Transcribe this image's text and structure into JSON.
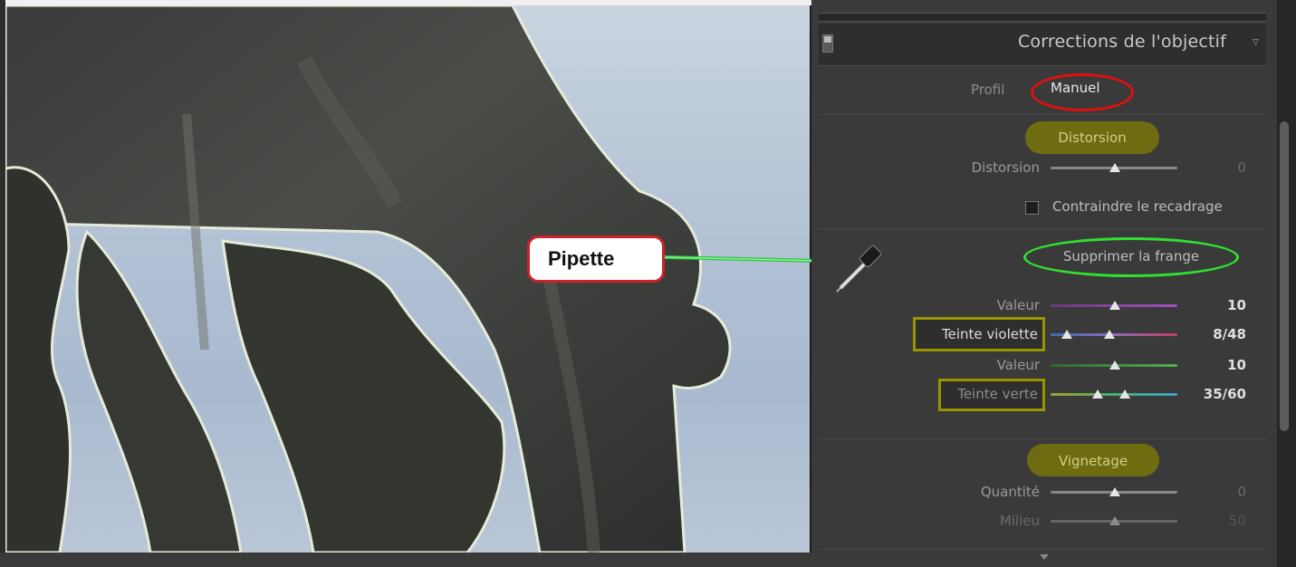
{
  "callout": {
    "label": "Pipette"
  },
  "panel": {
    "title": "Corrections de l'objectif",
    "profile": {
      "label": "Profil",
      "value": "Manuel"
    },
    "sections": {
      "distortion": {
        "title": "Distorsion",
        "slider_label": "Distorsion",
        "slider_value": "0",
        "constrain_label": "Contraindre le recadrage"
      },
      "fringe": {
        "title": "Supprimer la frange",
        "purple_amount_label": "Valeur",
        "purple_amount_value": "10",
        "purple_hue_label": "Teinte violette",
        "purple_hue_value": "8/48",
        "green_amount_label": "Valeur",
        "green_amount_value": "10",
        "green_hue_label": "Teinte verte",
        "green_hue_value": "35/60"
      },
      "vignetting": {
        "title": "Vignetage",
        "amount_label": "Quantité",
        "amount_value": "0",
        "midpoint_label": "Milieu",
        "midpoint_value": "50"
      }
    }
  },
  "colors": {
    "annotation_red": "#e01010",
    "annotation_green": "#31e031",
    "annotation_olive": "#9a9400",
    "callout_border": "#d0202a"
  },
  "icons": [
    "pipette-icon",
    "panel-switch-icon",
    "collapse-triangle-icon",
    "scroll-down-icon"
  ]
}
